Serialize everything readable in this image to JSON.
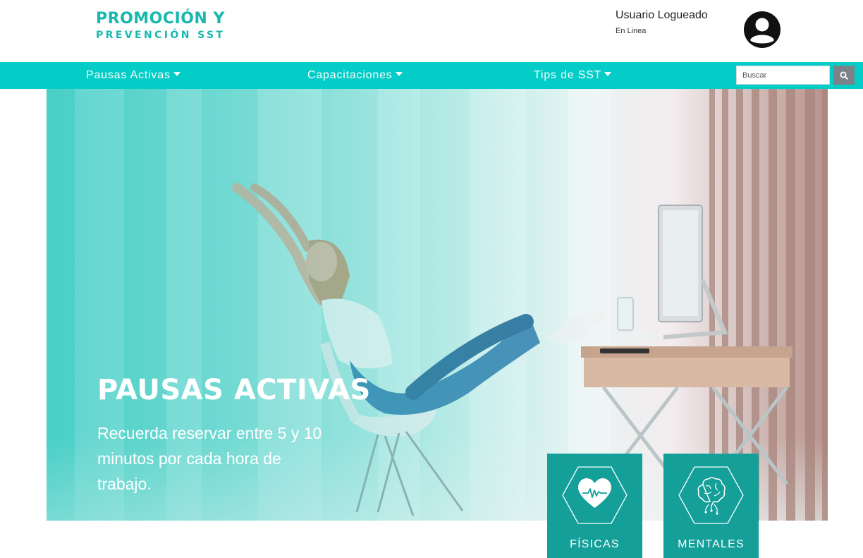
{
  "header": {
    "logo_line1": "PROMOCIÓN Y",
    "logo_line2": "PREVENCIÓN SST",
    "user_name": "Usuario Logueado",
    "user_status": "En Linea",
    "avatar_icon": "user-circle-icon"
  },
  "nav": {
    "items": [
      {
        "label": "Pausas Activas"
      },
      {
        "label": "Capacitaciones"
      },
      {
        "label": "Tips de SST"
      }
    ],
    "search_placeholder": "Buscar",
    "search_icon": "search-icon"
  },
  "hero": {
    "title": "PAUSAS ACTIVAS",
    "text": "Recuerda reservar entre 5 y 10 minutos por cada hora de trabajo."
  },
  "cards": [
    {
      "label": "FÍSICAS",
      "icon": "heart-pulse-icon"
    },
    {
      "label": "MENTALES",
      "icon": "brain-circuit-icon"
    }
  ],
  "colors": {
    "brand_teal": "#17b8ae",
    "navbar": "#03cdc6",
    "card": "#149f99",
    "search_button": "#7c8288"
  }
}
